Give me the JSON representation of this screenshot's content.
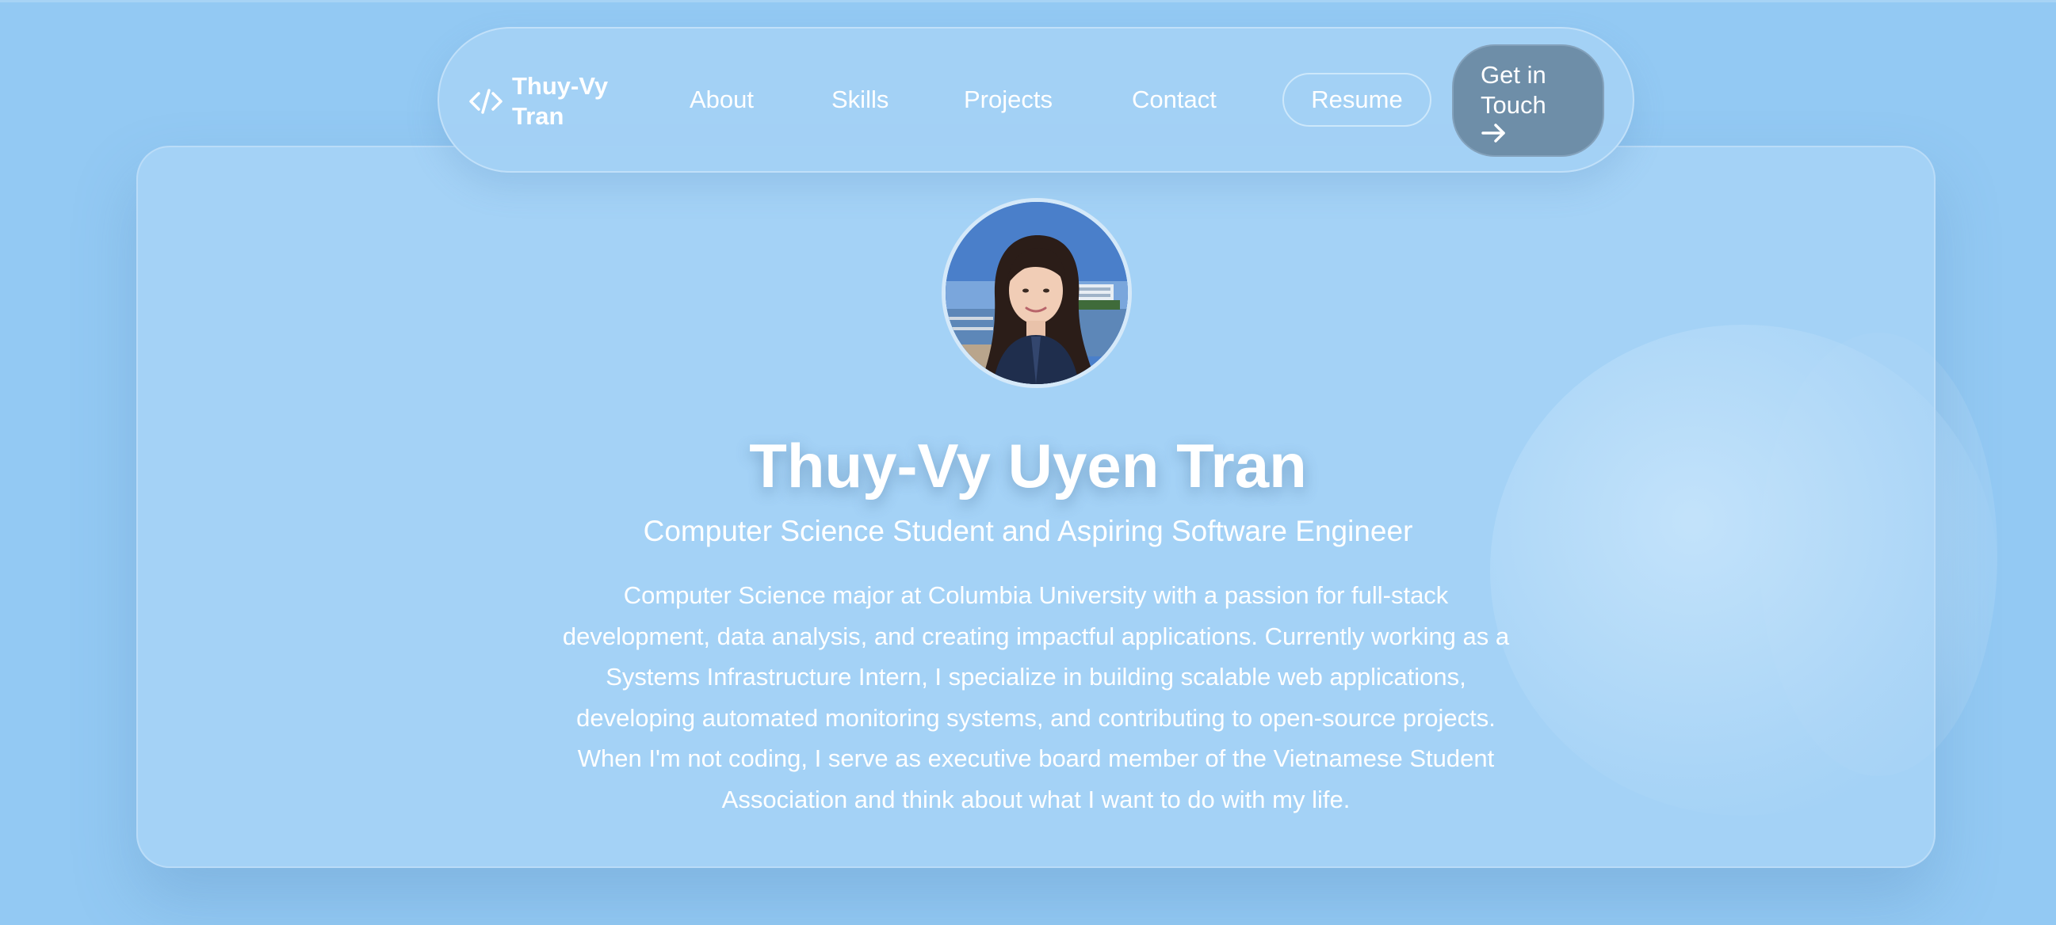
{
  "nav": {
    "brand_name": "Thuy-Vy Tran",
    "links": [
      "About",
      "Skills",
      "Projects",
      "Contact"
    ],
    "resume_label": "Resume",
    "cta_label": "Get in Touch",
    "brand_icon": "code-brackets-icon",
    "cta_icon": "arrow-right-icon"
  },
  "hero": {
    "avatar_icon": "profile-photo",
    "name": "Thuy-Vy Uyen Tran",
    "subtitle": "Computer Science Student and Aspiring Software Engineer",
    "bio": "Computer Science major at Columbia University with a passion for full-stack development, data analysis, and creating impactful applications. Currently working as a Systems Infrastructure Intern, I specialize in building scalable web applications, developing automated monitoring systems, and contributing to open-source projects. When I'm not coding, I serve as executive board member of the Vietnamese Student Association and think about what I want to do with my life."
  },
  "colors": {
    "background": "#93c9f3",
    "card": "#aad5f6",
    "cta": "#6e8ea8",
    "text": "#ffffff"
  }
}
